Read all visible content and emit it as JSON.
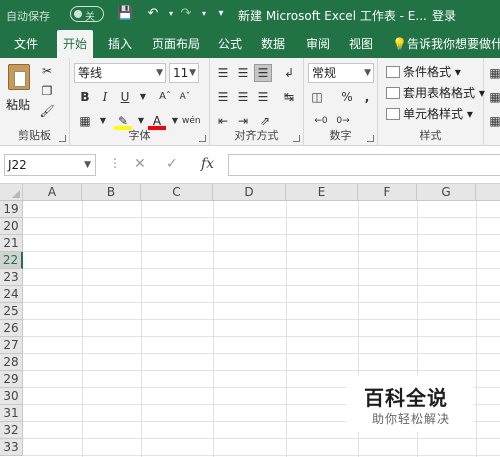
{
  "titlebar": {
    "autosave_label": "自动保存",
    "autosave_state": "关",
    "doc_title": "新建 Microsoft Excel 工作表 - E...",
    "login_label": "登录",
    "accent": "#217346"
  },
  "tabs": [
    {
      "label": "文件"
    },
    {
      "label": "开始"
    },
    {
      "label": "插入"
    },
    {
      "label": "页面布局"
    },
    {
      "label": "公式"
    },
    {
      "label": "数据"
    },
    {
      "label": "审阅"
    },
    {
      "label": "视图"
    }
  ],
  "tellme_label": "告诉我你想要做什么",
  "ribbon": {
    "clipboard": {
      "paste_label": "粘贴",
      "group_label": "剪贴板"
    },
    "font": {
      "font_name": "等线",
      "font_size": "11",
      "group_label": "字体",
      "bold": "B",
      "italic": "I",
      "underline": "U",
      "phonetic": "wén"
    },
    "alignment": {
      "group_label": "对齐方式"
    },
    "number": {
      "format": "常规",
      "group_label": "数字",
      "percent": "%",
      "comma": ","
    },
    "styles": {
      "conditional": "条件格式",
      "table": "套用表格格式",
      "cell": "单元格样式",
      "group_label": "样式"
    }
  },
  "formula_bar": {
    "name_box": "J22",
    "fx_label": "fx",
    "value": ""
  },
  "grid": {
    "columns": [
      "A",
      "B",
      "C",
      "D",
      "E",
      "F",
      "G"
    ],
    "rows": [
      "19",
      "20",
      "21",
      "22",
      "23",
      "24",
      "25",
      "26",
      "27",
      "28",
      "29",
      "30",
      "31",
      "32",
      "33"
    ],
    "active_row": "22"
  },
  "watermark": {
    "title": "百科全说",
    "subtitle": "助你轻松解决"
  }
}
